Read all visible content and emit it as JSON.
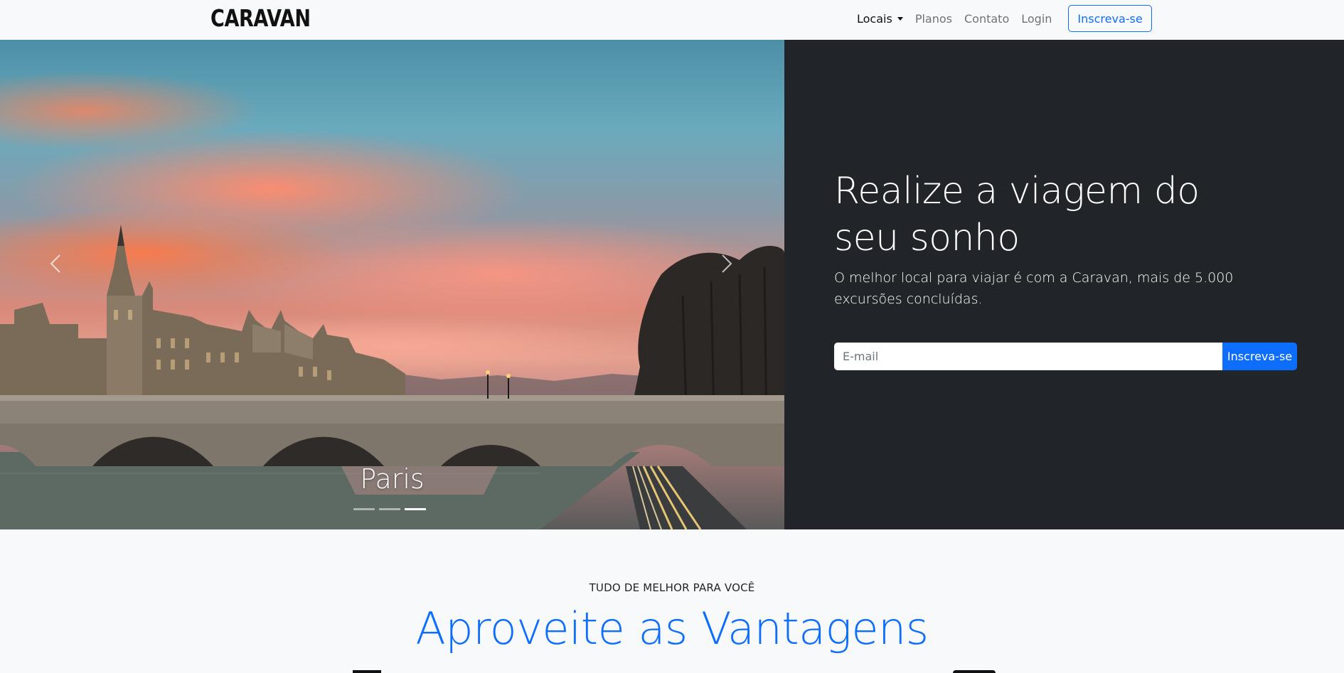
{
  "navbar": {
    "brand": "CARAVAN",
    "links": [
      {
        "label": "Locais",
        "active": true,
        "dropdown": true
      },
      {
        "label": "Planos"
      },
      {
        "label": "Contato"
      },
      {
        "label": "Login"
      }
    ],
    "cta_label": "Inscreva-se"
  },
  "carousel": {
    "caption": "Paris",
    "active_index": 2,
    "indicator_count": 3,
    "prev_icon": "chevron-left-icon",
    "next_icon": "chevron-right-icon"
  },
  "hero": {
    "headline": "Realize a viagem do seu sonho",
    "lead": "O melhor local para viajar é com a Caravan, mais de 5.000 excursões concluídas.",
    "email_placeholder": "E-mail",
    "submit_label": "Inscreva-se"
  },
  "section": {
    "eyebrow": "TUDO DE MELHOR PARA VOCÊ",
    "title": "Aproveite as Vantagens"
  },
  "colors": {
    "primary": "#0d6efd",
    "dark": "#212529",
    "light": "#f8f9fa"
  }
}
